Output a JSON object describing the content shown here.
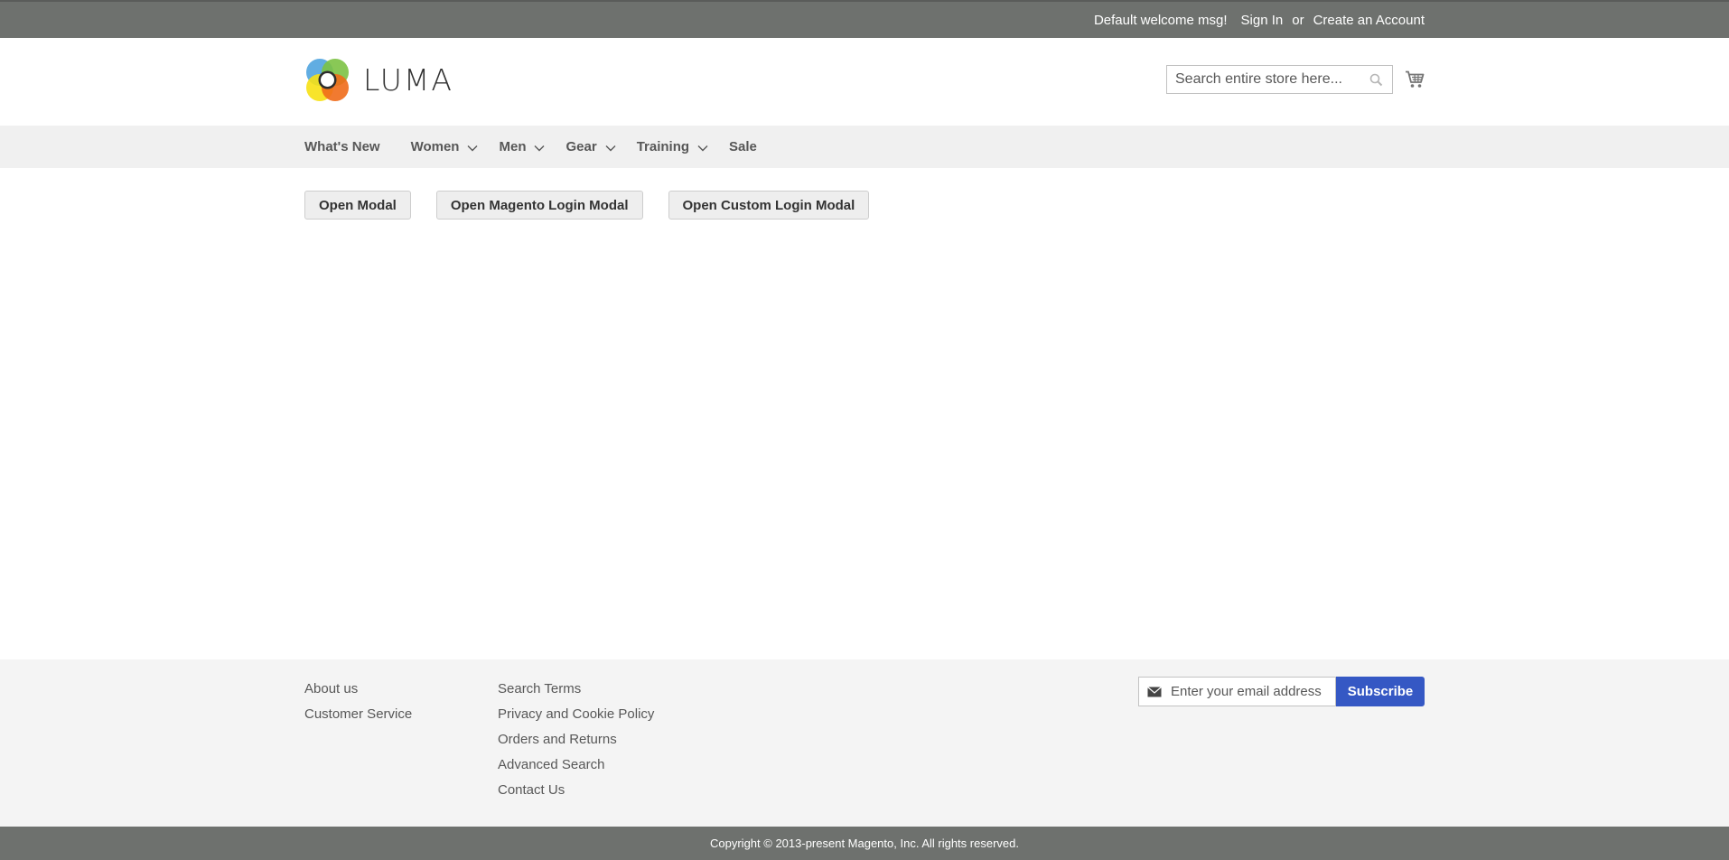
{
  "top_bar": {
    "welcome": "Default welcome msg!",
    "sign_in": "Sign In",
    "or": "or",
    "create_account": "Create an Account"
  },
  "header": {
    "logo_text": "LUMA",
    "search_placeholder": "Search entire store here...",
    "icons": {
      "search": "search-icon",
      "cart": "cart-icon"
    }
  },
  "nav": {
    "items": [
      {
        "label": "What's New",
        "dropdown": false
      },
      {
        "label": "Women",
        "dropdown": true
      },
      {
        "label": "Men",
        "dropdown": true
      },
      {
        "label": "Gear",
        "dropdown": true
      },
      {
        "label": "Training",
        "dropdown": true
      },
      {
        "label": "Sale",
        "dropdown": false
      }
    ]
  },
  "main": {
    "buttons": [
      "Open Modal",
      "Open Magento Login Modal",
      "Open Custom Login Modal"
    ]
  },
  "footer": {
    "col1": [
      "About us",
      "Customer Service"
    ],
    "col2": [
      "Search Terms",
      "Privacy and Cookie Policy",
      "Orders and Returns",
      "Advanced Search",
      "Contact Us"
    ],
    "newsletter_placeholder": "Enter your email address",
    "subscribe_label": "Subscribe"
  },
  "copyright": "Copyright © 2013-present Magento, Inc. All rights reserved.",
  "colors": {
    "top_bar_bg": "#6e716e",
    "nav_bg": "#f0f0f0",
    "footer_bg": "#f4f4f4",
    "subscribe_bg": "#3558c4"
  }
}
